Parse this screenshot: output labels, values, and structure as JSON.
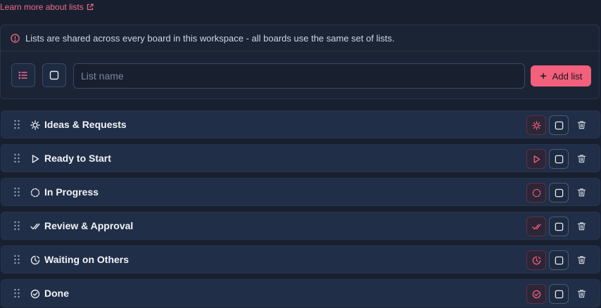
{
  "header": {
    "learn_more": "Learn more about lists"
  },
  "notice": {
    "text": "Lists are shared across every board in this workspace - all boards use the same set of lists."
  },
  "creator": {
    "placeholder": "List name",
    "add_label": "Add list"
  },
  "lists": [
    {
      "label": "Ideas & Requests",
      "icon": "lightbulb-icon"
    },
    {
      "label": "Ready to Start",
      "icon": "play-icon"
    },
    {
      "label": "In Progress",
      "icon": "progress-circle-icon"
    },
    {
      "label": "Review & Approval",
      "icon": "double-check-icon"
    },
    {
      "label": "Waiting on Others",
      "icon": "clock-icon"
    },
    {
      "label": "Done",
      "icon": "check-circle-icon"
    }
  ],
  "colors": {
    "accent": "#f2607c",
    "background": "#182030",
    "row": "#212e47"
  }
}
